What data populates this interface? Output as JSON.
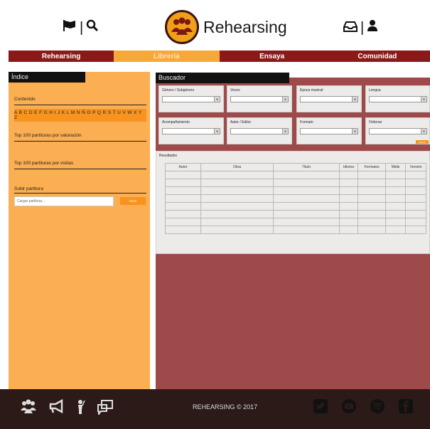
{
  "header": {
    "app_name": "Rehearsing",
    "left_icons": [
      "flag-icon",
      "search-icon"
    ],
    "right_icons": [
      "inbox-icon",
      "user-icon"
    ],
    "separator": "|"
  },
  "nav": {
    "items": [
      {
        "label": "Rehearsing",
        "active": false
      },
      {
        "label": "Librería",
        "active": true
      },
      {
        "label": "Ensaya",
        "active": false
      },
      {
        "label": "Comunidad",
        "active": false
      }
    ]
  },
  "sidebar": {
    "title": "Índice",
    "contenido_label": "Contenido",
    "alphabet": "A B C D E F G H I J K L M N Ñ O P Q R S T U V W X Y Z",
    "top_valoracion": "Top 100 partituras por valoración",
    "top_visitas": "Top 100 partituras por visitas",
    "subir_label": "Subir partitura",
    "upload_placeholder": "Cargar partitura...",
    "upload_button": "Subir"
  },
  "buscador": {
    "title": "Buscador",
    "filters": [
      {
        "label": "Género / Subgénero"
      },
      {
        "label": "Voces"
      },
      {
        "label": "Época musical"
      },
      {
        "label": "Lengua"
      },
      {
        "label": "Acompañamiento"
      },
      {
        "label": "Autor / Editor"
      },
      {
        "label": "Formato"
      },
      {
        "label": "Ordenar"
      }
    ],
    "search_button": "Buscar",
    "results_label": "Resultados",
    "columns": [
      "Autor",
      "Obra",
      "Título",
      "Idioma",
      "Formatos",
      "Midis",
      "Versión"
    ],
    "row_count": 8
  },
  "footer": {
    "copyright": "REHEARSING © 2017",
    "left_icons": [
      "group-icon",
      "megaphone-icon",
      "conductor-icon",
      "chat-icon"
    ],
    "right_icons": [
      "twitter-icon",
      "youtube-icon",
      "spotify-icon",
      "facebook-icon"
    ]
  },
  "colors": {
    "nav_bg": "#8a1a1a",
    "nav_active": "#f7a83a",
    "sidebar_bg": "#fbae52",
    "main_bg": "#9e4a4a",
    "footer_bg": "#2b1a17",
    "accent": "#f7931e"
  }
}
